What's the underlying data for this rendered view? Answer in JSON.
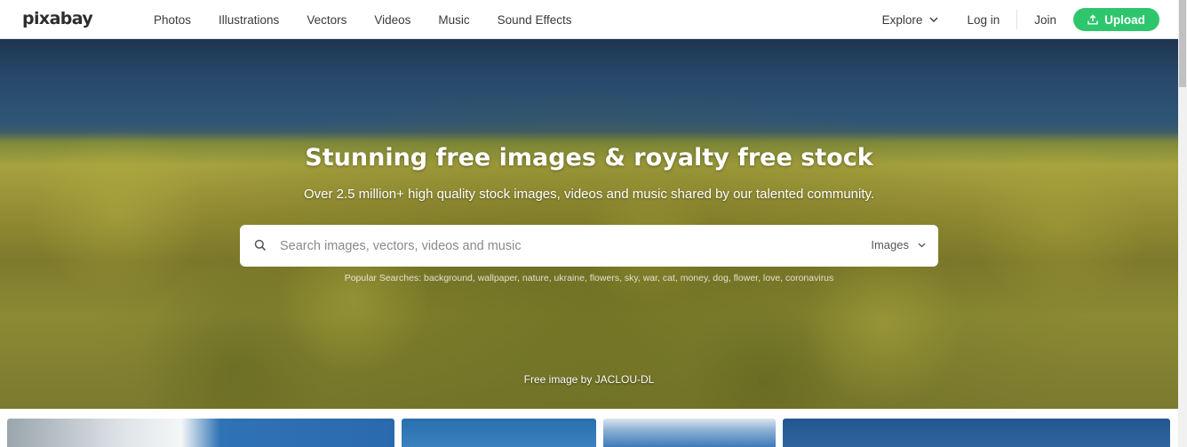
{
  "header": {
    "logo": "pixabay",
    "nav": [
      "Photos",
      "Illustrations",
      "Vectors",
      "Videos",
      "Music",
      "Sound Effects"
    ],
    "explore_label": "Explore",
    "login_label": "Log in",
    "join_label": "Join",
    "upload_label": "Upload",
    "accent_color": "#2ec66d"
  },
  "hero": {
    "title": "Stunning free images & royalty free stock",
    "subtitle": "Over 2.5 million+ high quality stock images, videos and music shared by our talented community.",
    "search": {
      "placeholder": "Search images, vectors, videos and music",
      "value": "",
      "type_selected": "Images"
    },
    "popular_searches": "Popular Searches: background, wallpaper, nature, ukraine, flowers, sky, war, cat, money, dog, flower, love, coronavirus",
    "credit": "Free image by JACLOU-DL"
  },
  "icons": {
    "search": "search-icon",
    "chevron": "chevron-down-icon",
    "upload": "upload-icon"
  }
}
